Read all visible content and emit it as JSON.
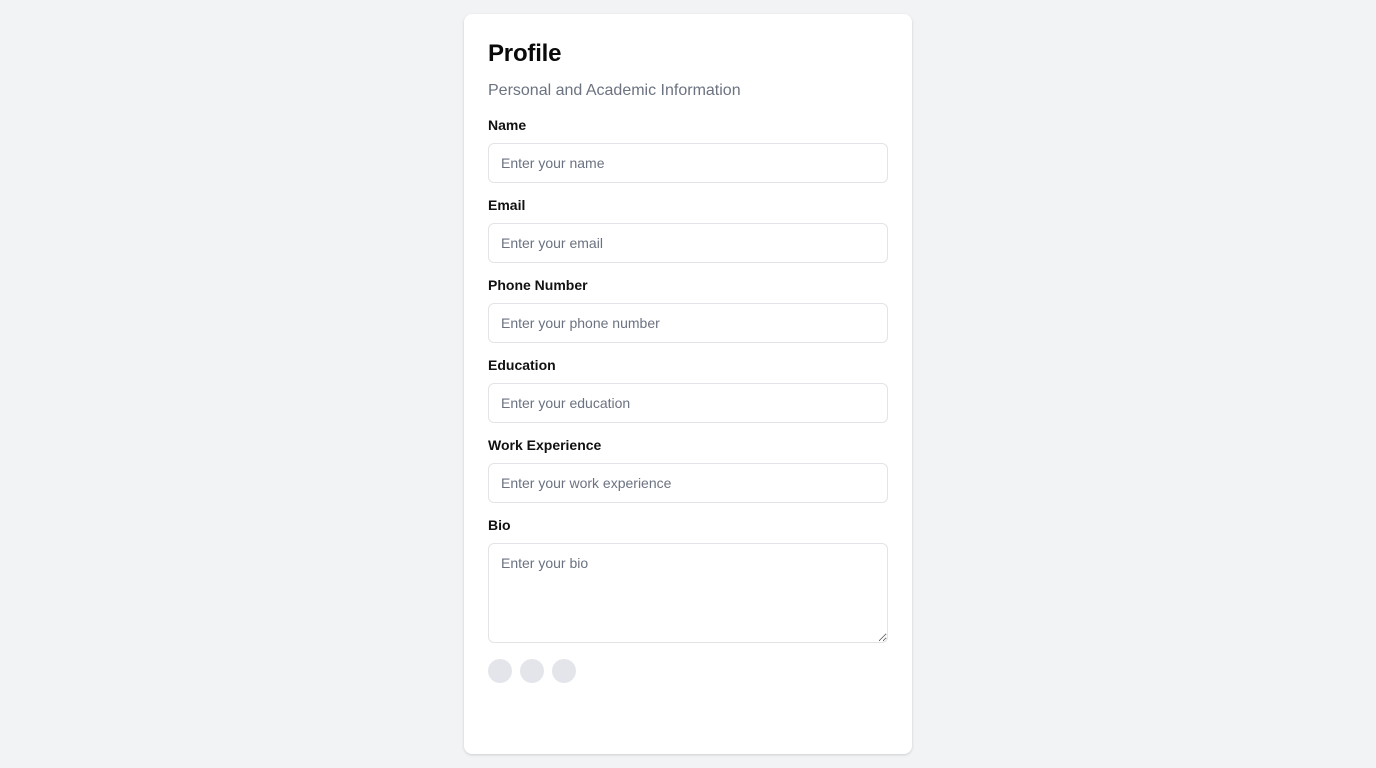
{
  "profile": {
    "title": "Profile",
    "subtitle": "Personal and Academic Information"
  },
  "fields": {
    "name": {
      "label": "Name",
      "placeholder": "Enter your name",
      "value": ""
    },
    "email": {
      "label": "Email",
      "placeholder": "Enter your email",
      "value": ""
    },
    "phone": {
      "label": "Phone Number",
      "placeholder": "Enter your phone number",
      "value": ""
    },
    "education": {
      "label": "Education",
      "placeholder": "Enter your education",
      "value": ""
    },
    "work": {
      "label": "Work Experience",
      "placeholder": "Enter your work experience",
      "value": ""
    },
    "bio": {
      "label": "Bio",
      "placeholder": "Enter your bio",
      "value": ""
    }
  },
  "colors": {
    "page_background": "#f2f3f5",
    "card_background": "#ffffff",
    "input_border": "#e2e4e8",
    "placeholder_text": "#6b7280",
    "dot_fill": "#e4e5ea"
  }
}
